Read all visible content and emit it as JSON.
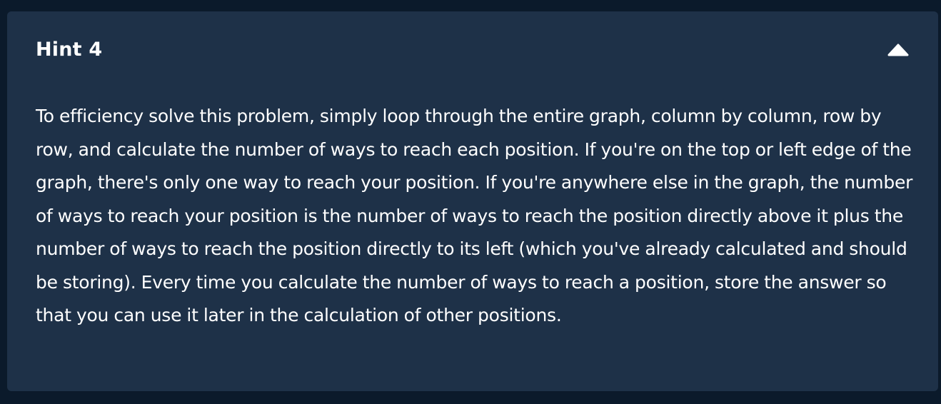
{
  "hint": {
    "title": "Hint 4",
    "toggle_icon": "chevron-up-icon",
    "body": "To efficiency solve this problem, simply loop through the entire graph, column by column, row by row, and calculate the number of ways to reach each position. If you're on the top or left edge of the graph, there's only one way to reach your position. If you're anywhere else in the graph, the number of ways to reach your position is the number of ways to reach the position directly above it plus the number of ways to reach the position directly to its left (which you've already calculated and should be storing). Every time you calculate the number of ways to reach a position, store the answer so that you can use it later in the calculation of other positions."
  },
  "colors": {
    "page_background": "#0b1a2b",
    "panel_background": "#1e3148",
    "text": "#ffffff"
  }
}
